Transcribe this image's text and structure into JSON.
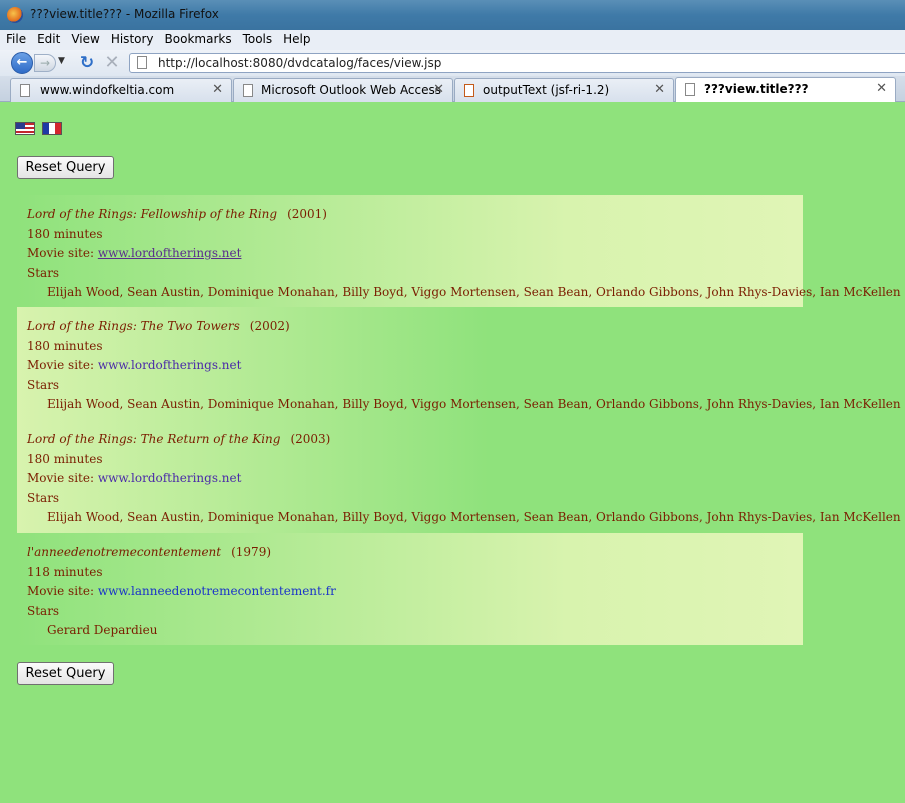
{
  "window": {
    "title": "???view.title??? - Mozilla Firefox"
  },
  "menu": [
    "File",
    "Edit",
    "View",
    "History",
    "Bookmarks",
    "Tools",
    "Help"
  ],
  "url": "http://localhost:8080/dvdcatalog/faces/view.jsp",
  "tabs": [
    {
      "label": "www.windofkeltia.com"
    },
    {
      "label": "Microsoft Outlook Web Access"
    },
    {
      "label": "outputText (jsf-ri-1.2)"
    },
    {
      "label": "???view.title???"
    }
  ],
  "buttons": {
    "reset_top": "Reset Query",
    "reset_bottom": "Reset Query"
  },
  "movies": [
    {
      "title": "Lord of the Rings: Fellowship of the Ring",
      "year": "(2001)",
      "duration": "180 minutes",
      "site_label": "Movie site: ",
      "site": "www.lordoftherings.net",
      "stars_label": "Stars",
      "stars": "Elijah Wood, Sean Austin, Dominique Monahan, Billy Boyd, Viggo Mortensen, Sean Bean, Orlando Gibbons, John Rhys-Davies, Ian McKellen"
    },
    {
      "title": "Lord of the Rings: The Two Towers",
      "year": "(2002)",
      "duration": "180 minutes",
      "site_label": "Movie site: ",
      "site": "www.lordoftherings.net",
      "stars_label": "Stars",
      "stars": "Elijah Wood, Sean Austin, Dominique Monahan, Billy Boyd, Viggo Mortensen, Sean Bean, Orlando Gibbons, John Rhys-Davies, Ian McKellen"
    },
    {
      "title": "Lord of the Rings: The Return of the King",
      "year": "(2003)",
      "duration": "180 minutes",
      "site_label": "Movie site: ",
      "site": "www.lordoftherings.net",
      "stars_label": "Stars",
      "stars": "Elijah Wood, Sean Austin, Dominique Monahan, Billy Boyd, Viggo Mortensen, Sean Bean, Orlando Gibbons, John Rhys-Davies, Ian McKellen"
    },
    {
      "title": "l'anneedenotremecontentement",
      "year": "(1979)",
      "duration": "118 minutes",
      "site_label": "Movie site: ",
      "site": "www.lanneedenotremecontentement.fr",
      "stars_label": "Stars",
      "stars": "Gerard Depardieu"
    }
  ],
  "colors": {
    "page_bg": "#8fe27c",
    "text": "#7a1d00",
    "link": "#4a2aa8"
  }
}
